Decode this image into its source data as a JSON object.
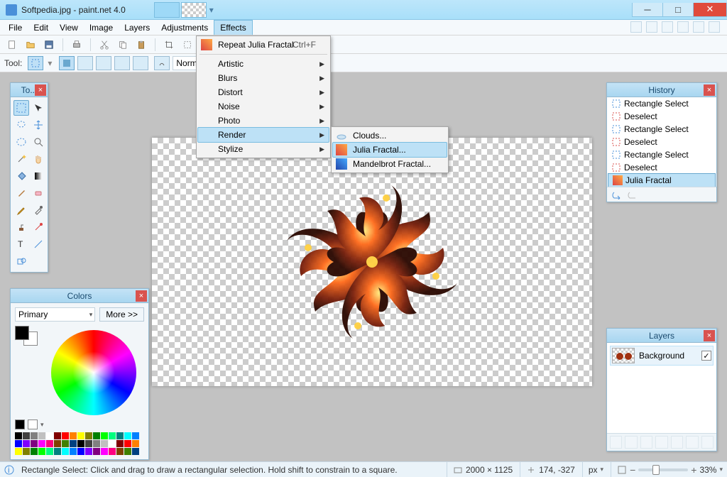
{
  "title": "Softpedia.jpg - paint.net 4.0",
  "menubar": [
    "File",
    "Edit",
    "View",
    "Image",
    "Layers",
    "Adjustments",
    "Effects"
  ],
  "toolRow2": {
    "label": "Tool:",
    "blend_label": "Normal"
  },
  "effectsMenu": {
    "repeat": {
      "label": "Repeat Julia Fractal",
      "shortcut": "Ctrl+F"
    },
    "items": [
      "Artistic",
      "Blurs",
      "Distort",
      "Noise",
      "Photo",
      "Render",
      "Stylize"
    ]
  },
  "renderSubmenu": [
    "Clouds...",
    "Julia Fractal...",
    "Mandelbrot Fractal..."
  ],
  "toolsPanel": {
    "title": "To..."
  },
  "colorsPanel": {
    "title": "Colors",
    "primary": "Primary",
    "more": "More >>"
  },
  "historyPanel": {
    "title": "History",
    "items": [
      "Rectangle Select",
      "Deselect",
      "Rectangle Select",
      "Deselect",
      "Rectangle Select",
      "Deselect",
      "Julia Fractal"
    ]
  },
  "layersPanel": {
    "title": "Layers",
    "bg": "Background"
  },
  "status": {
    "hint": "Rectangle Select: Click and drag to draw a rectangular selection. Hold shift to constrain to a square.",
    "dims": "2000 × 1125",
    "cursor": "174, -327",
    "unit": "px",
    "zoom": "33%"
  },
  "palette": [
    "#000",
    "#404040",
    "#808080",
    "#c0c0c0",
    "#fff",
    "#800000",
    "#f00",
    "#ff8000",
    "#ff0",
    "#808000",
    "#008000",
    "#0f0",
    "#00ff80",
    "#008080",
    "#0ff",
    "#0080ff",
    "#0000ff",
    "#8000ff",
    "#800080",
    "#f0f",
    "#ff0080",
    "#804000",
    "#408000",
    "#004080"
  ]
}
